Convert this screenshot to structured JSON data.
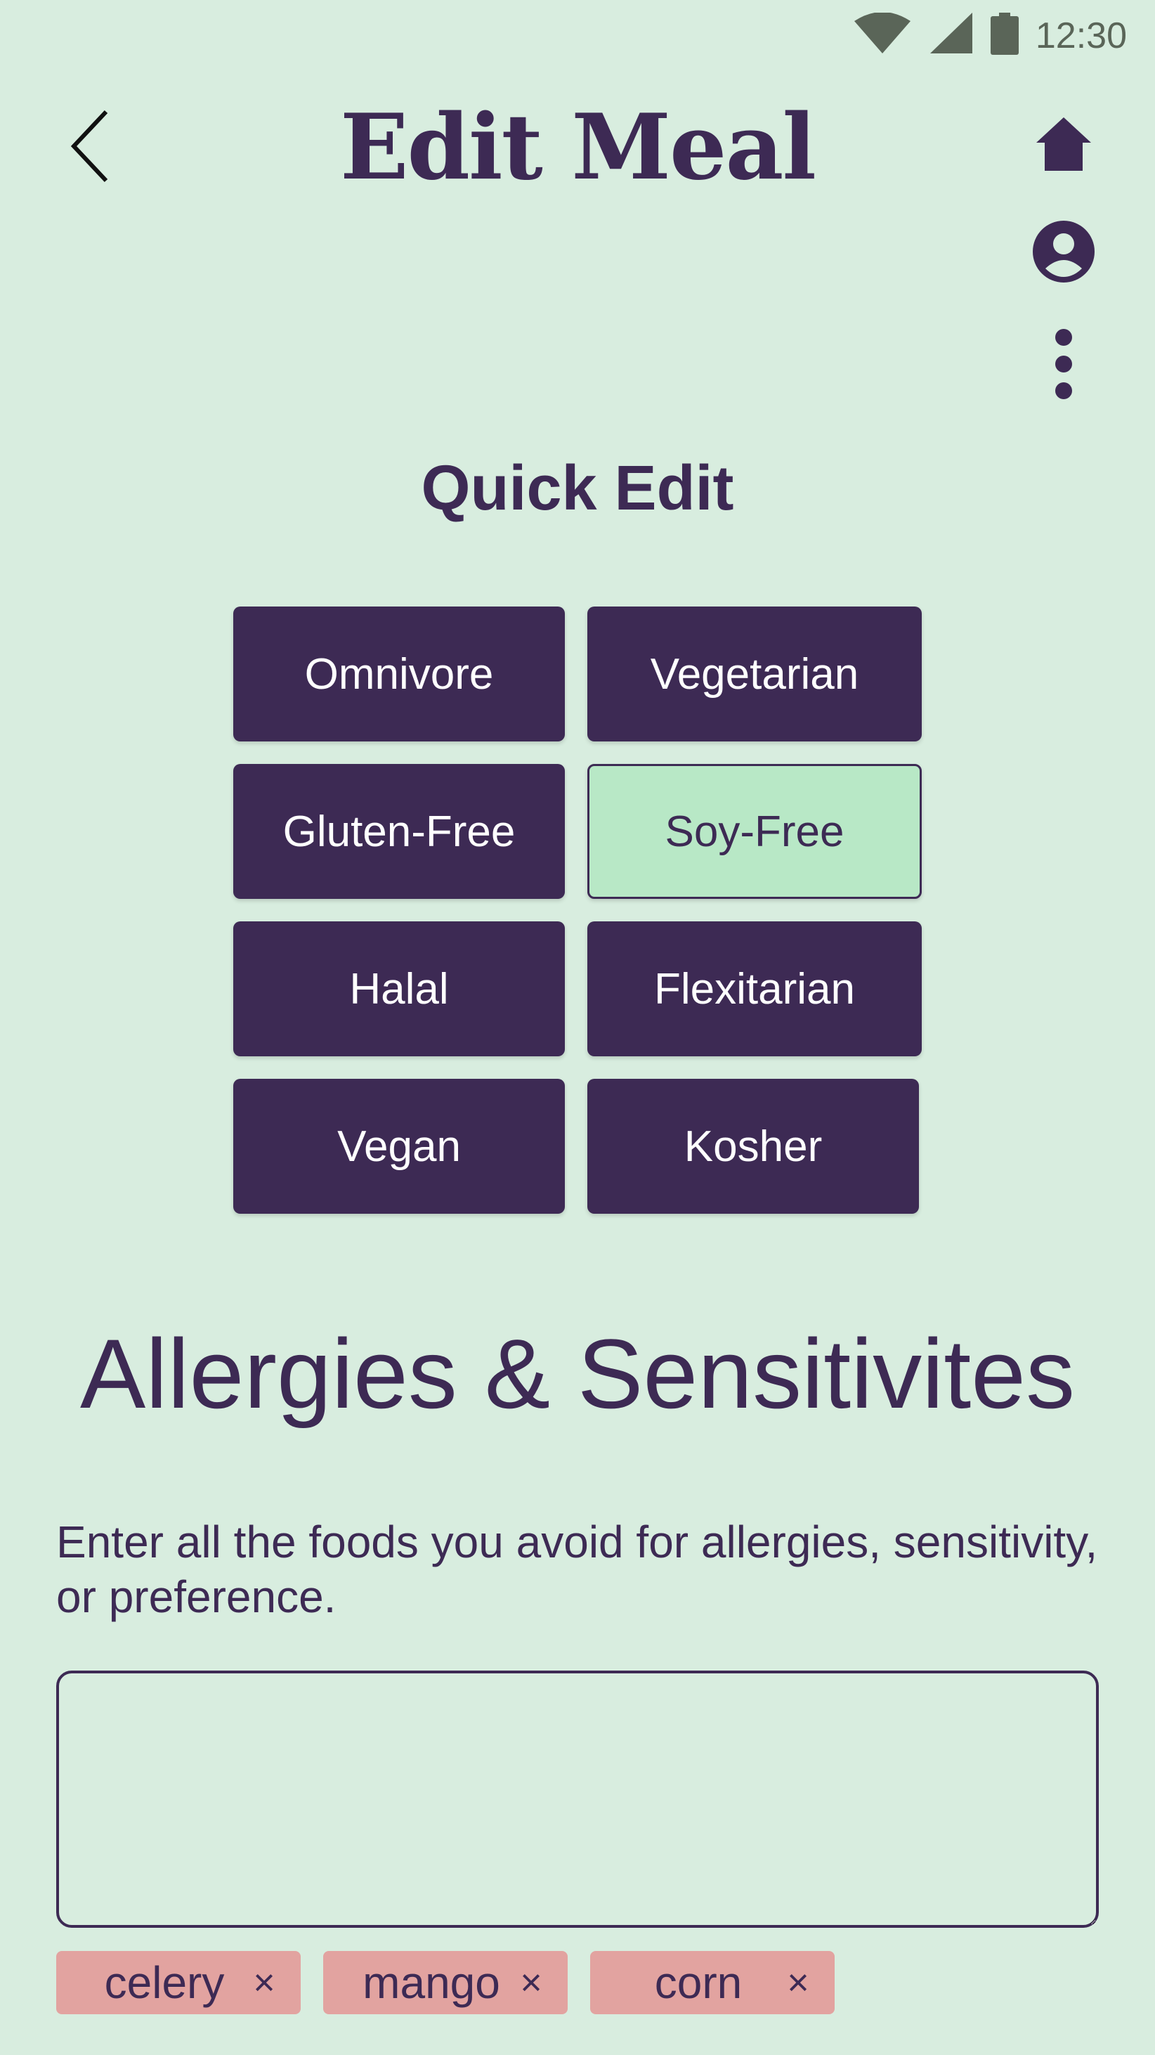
{
  "status_bar": {
    "time": "12:30",
    "icons": [
      "wifi-icon",
      "signal-icon",
      "battery-icon"
    ]
  },
  "app_bar": {
    "title": "Edit Meal",
    "back_icon": "chevron-left-icon",
    "actions": [
      "home-icon",
      "account-icon",
      "more-vertical-icon"
    ]
  },
  "quick_edit": {
    "title": "Quick Edit",
    "options": [
      {
        "label": "Omnivore",
        "selected": false
      },
      {
        "label": "Vegetarian",
        "selected": false
      },
      {
        "label": "Gluten-Free",
        "selected": false
      },
      {
        "label": "Soy-Free",
        "selected": true
      },
      {
        "label": "Halal",
        "selected": false
      },
      {
        "label": "Flexitarian",
        "selected": false
      },
      {
        "label": "Vegan",
        "selected": false
      },
      {
        "label": "Kosher",
        "selected": false
      }
    ]
  },
  "allergies": {
    "title": "Allergies & Sensitivites",
    "description": "Enter all the foods you avoid for allergies, sensitivity, or preference.",
    "input_value": "",
    "input_placeholder": "",
    "chips": [
      {
        "label": "celery",
        "remove": "×"
      },
      {
        "label": "mango",
        "remove": "×"
      },
      {
        "label": "corn",
        "remove": "×"
      }
    ]
  },
  "colors": {
    "background": "#d8eddf",
    "primary": "#3d2a54",
    "selected": "#b8e8c6",
    "chip": "#e2a3a0"
  }
}
